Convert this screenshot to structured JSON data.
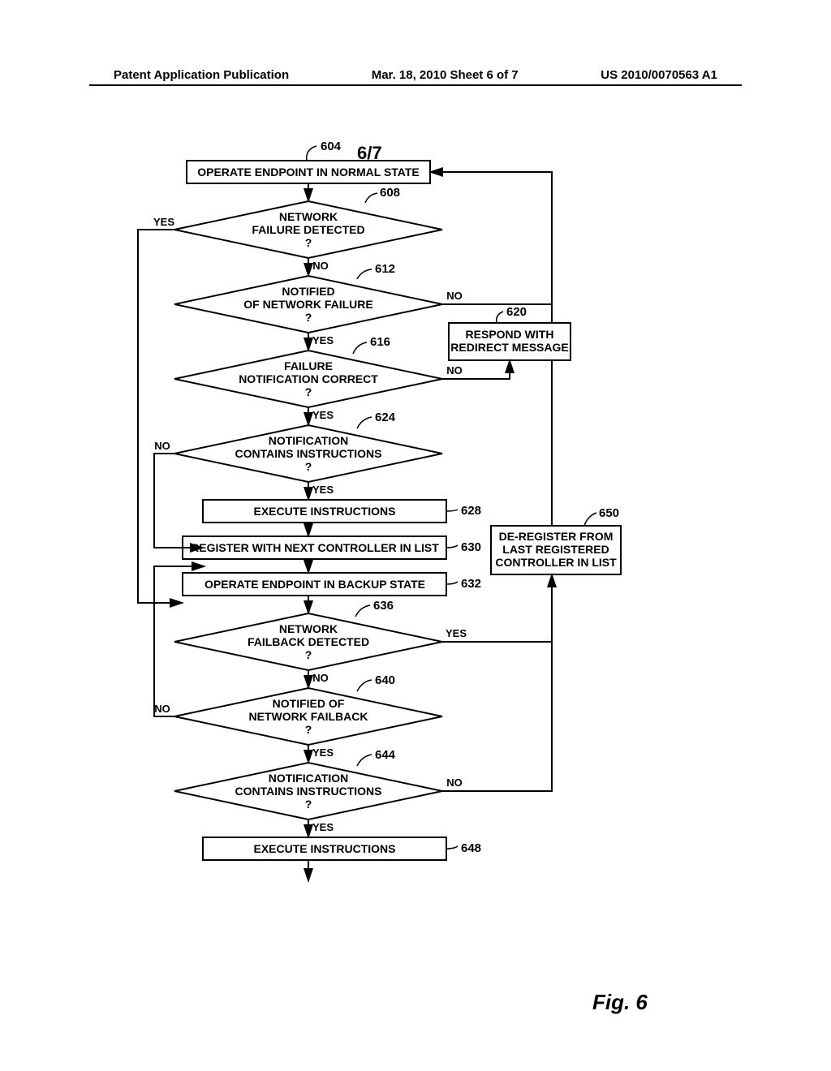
{
  "header": {
    "left": "Patent Application Publication",
    "center": "Mar. 18, 2010  Sheet 6 of 7",
    "right": "US 2010/0070563 A1"
  },
  "sheet_fraction": "6/7",
  "figure_caption": "Fig. 6",
  "refs": {
    "r604": "604",
    "r608": "608",
    "r612": "612",
    "r616": "616",
    "r620": "620",
    "r624": "624",
    "r628": "628",
    "r630": "630",
    "r632": "632",
    "r636": "636",
    "r640": "640",
    "r644": "644",
    "r648": "648",
    "r650": "650"
  },
  "boxes": {
    "b604": "OPERATE ENDPOINT IN NORMAL STATE",
    "b620a": "RESPOND WITH",
    "b620b": "REDIRECT MESSAGE",
    "b628": "EXECUTE INSTRUCTIONS",
    "b630": "REGISTER WITH NEXT CONTROLLER IN LIST",
    "b632": "OPERATE ENDPOINT IN BACKUP STATE",
    "b648": "EXECUTE INSTRUCTIONS",
    "b650a": "DE-REGISTER FROM",
    "b650b": "LAST REGISTERED",
    "b650c": "CONTROLLER IN LIST"
  },
  "diamonds": {
    "d608a": "NETWORK",
    "d608b": "FAILURE DETECTED",
    "d608c": "?",
    "d612a": "NOTIFIED",
    "d612b": "OF NETWORK FAILURE",
    "d612c": "?",
    "d616a": "FAILURE",
    "d616b": "NOTIFICATION CORRECT",
    "d616c": "?",
    "d624a": "NOTIFICATION",
    "d624b": "CONTAINS INSTRUCTIONS",
    "d624c": "?",
    "d636a": "NETWORK",
    "d636b": "FAILBACK DETECTED",
    "d636c": "?",
    "d640a": "NOTIFIED OF",
    "d640b": "NETWORK FAILBACK",
    "d640c": "?",
    "d644a": "NOTIFICATION",
    "d644b": "CONTAINS INSTRUCTIONS",
    "d644c": "?"
  },
  "labels": {
    "yes": "YES",
    "no": "NO"
  }
}
